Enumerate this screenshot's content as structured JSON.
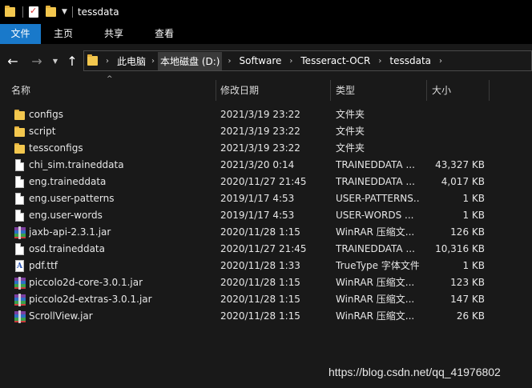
{
  "title_bar": {
    "title": "tessdata",
    "quick_access": [
      "folder-icon",
      "properties-icon",
      "new-folder-icon"
    ]
  },
  "ribbon": {
    "tabs": [
      "文件",
      "主页",
      "共享",
      "查看"
    ],
    "active_color": "#1979ca"
  },
  "address": {
    "breadcrumbs": [
      "此电脑",
      "本地磁盘 (D:)",
      "Software",
      "Tesseract-OCR",
      "tessdata"
    ],
    "selected_crumb": "本地磁盘 (D:)"
  },
  "columns": {
    "name": "名称",
    "date": "修改日期",
    "type": "类型",
    "size": "大小"
  },
  "files": [
    {
      "icon": "folder-icon",
      "name": "configs",
      "date": "2021/3/19 23:22",
      "type": "文件夹",
      "size": ""
    },
    {
      "icon": "folder-icon",
      "name": "script",
      "date": "2021/3/19 23:22",
      "type": "文件夹",
      "size": ""
    },
    {
      "icon": "folder-icon",
      "name": "tessconfigs",
      "date": "2021/3/19 23:22",
      "type": "文件夹",
      "size": ""
    },
    {
      "icon": "file-icon",
      "name": "chi_sim.traineddata",
      "date": "2021/3/20 0:14",
      "type": "TRAINEDDATA ...",
      "size": "43,327 KB"
    },
    {
      "icon": "file-icon",
      "name": "eng.traineddata",
      "date": "2020/11/27 21:45",
      "type": "TRAINEDDATA ...",
      "size": "4,017 KB"
    },
    {
      "icon": "file-icon",
      "name": "eng.user-patterns",
      "date": "2019/1/17 4:53",
      "type": "USER-PATTERNS...",
      "size": "1 KB"
    },
    {
      "icon": "file-icon",
      "name": "eng.user-words",
      "date": "2019/1/17 4:53",
      "type": "USER-WORDS ...",
      "size": "1 KB"
    },
    {
      "icon": "rar-icon",
      "name": "jaxb-api-2.3.1.jar",
      "date": "2020/11/28 1:15",
      "type": "WinRAR 压缩文...",
      "size": "126 KB"
    },
    {
      "icon": "file-icon",
      "name": "osd.traineddata",
      "date": "2020/11/27 21:45",
      "type": "TRAINEDDATA ...",
      "size": "10,316 KB"
    },
    {
      "icon": "font-icon",
      "name": "pdf.ttf",
      "date": "2020/11/28 1:33",
      "type": "TrueType 字体文件",
      "size": "1 KB"
    },
    {
      "icon": "rar-icon",
      "name": "piccolo2d-core-3.0.1.jar",
      "date": "2020/11/28 1:15",
      "type": "WinRAR 压缩文...",
      "size": "123 KB"
    },
    {
      "icon": "rar-icon",
      "name": "piccolo2d-extras-3.0.1.jar",
      "date": "2020/11/28 1:15",
      "type": "WinRAR 压缩文...",
      "size": "147 KB"
    },
    {
      "icon": "rar-icon",
      "name": "ScrollView.jar",
      "date": "2020/11/28 1:15",
      "type": "WinRAR 压缩文...",
      "size": "26 KB"
    }
  ],
  "watermark": "https://blog.csdn.net/qq_41976802"
}
